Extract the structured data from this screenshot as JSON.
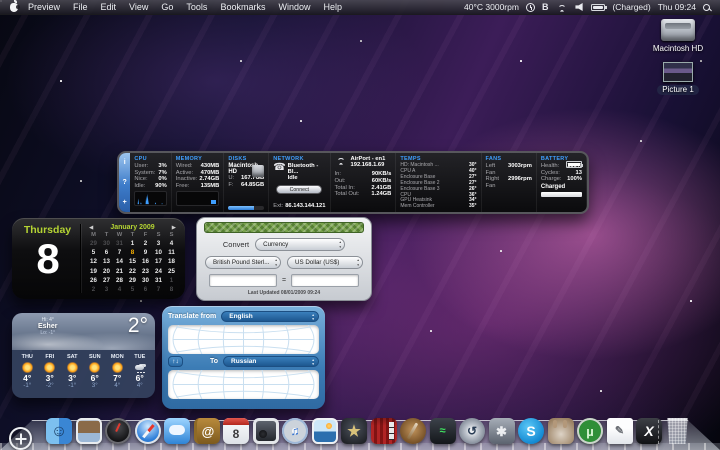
{
  "menu_bar": {
    "menus": [
      "Preview",
      "File",
      "Edit",
      "View",
      "Go",
      "Tools",
      "Bookmarks",
      "Window",
      "Help"
    ],
    "status_text": "40°C 3000rpm",
    "bluetooth_glyph": "B",
    "battery_label": "(Charged)",
    "clock": "Thu 09:24"
  },
  "desktop": {
    "hd_label": "Macintosh HD",
    "picture_label": "Picture 1"
  },
  "istat": {
    "strip_buttons": [
      "i",
      "?",
      "+"
    ],
    "cpu": {
      "header": "CPU",
      "rows": [
        {
          "l": "User:",
          "v": "3%"
        },
        {
          "l": "System:",
          "v": "7%"
        },
        {
          "l": "Nice:",
          "v": "0%"
        },
        {
          "l": "Idle:",
          "v": "90%"
        }
      ]
    },
    "memory": {
      "header": "MEMORY",
      "rows": [
        {
          "l": "Wired:",
          "v": "430MB"
        },
        {
          "l": "Active:",
          "v": "470MB"
        },
        {
          "l": "Inactive:",
          "v": "2.74GB"
        },
        {
          "l": "Free:",
          "v": "135MB"
        }
      ]
    },
    "disks": {
      "header": "DISKS",
      "volume": "Macintosh HD",
      "rows": [
        {
          "l": "U:",
          "v": "167.7GB"
        },
        {
          "l": "F:",
          "v": "64.85GB"
        }
      ]
    },
    "network": {
      "header": "NETWORK",
      "device": "Bluetooth - Bl...",
      "state": "Idle",
      "connect_label": "Connect",
      "ext": {
        "l": "Ext:",
        "v": "86.143.144.121"
      }
    },
    "airport": {
      "name": "AirPort - en1",
      "ip": "192.168.1.69",
      "rows": [
        {
          "l": "In:",
          "v": "90KB/s"
        },
        {
          "l": "Out:",
          "v": "60KB/s"
        },
        {
          "l": "Total In:",
          "v": "2.41GB"
        },
        {
          "l": "Total Out:",
          "v": "1.24GB"
        }
      ]
    },
    "temps": {
      "header": "TEMPS",
      "rows": [
        {
          "l": "HD: Macintosh ...",
          "v": "30°"
        },
        {
          "l": "CPU A",
          "v": "40°"
        },
        {
          "l": "Enclosure Base",
          "v": "27°"
        },
        {
          "l": "Enclosure Base 2",
          "v": "27°"
        },
        {
          "l": "Enclosure Base 3",
          "v": "26°"
        },
        {
          "l": "CPU",
          "v": "36°"
        },
        {
          "l": "GPU Heatsink",
          "v": "34°"
        },
        {
          "l": "Mem Controller",
          "v": "35°"
        }
      ]
    },
    "fans": {
      "header": "FANS",
      "rows": [
        {
          "l": "Left Fan",
          "v": "3003rpm"
        },
        {
          "l": "Right Fan",
          "v": "2996rpm"
        }
      ]
    },
    "battery": {
      "header": "BATTERY",
      "rows": [
        {
          "l": "Health:",
          "v": "100%"
        },
        {
          "l": "Cycles:",
          "v": "13"
        },
        {
          "l": "Charge:",
          "v": "100%"
        }
      ],
      "state": "Charged"
    }
  },
  "calendar": {
    "day_name": "Thursday",
    "big_day": "8",
    "prev": "◀",
    "next": "▶",
    "month": "January 2009",
    "dow": [
      "M",
      "T",
      "W",
      "T",
      "F",
      "S",
      "S"
    ],
    "cells": [
      {
        "d": "29",
        "c": "dim"
      },
      {
        "d": "30",
        "c": "dim"
      },
      {
        "d": "31",
        "c": "dim"
      },
      {
        "d": "1"
      },
      {
        "d": "2"
      },
      {
        "d": "3"
      },
      {
        "d": "4"
      },
      {
        "d": "5"
      },
      {
        "d": "6"
      },
      {
        "d": "7"
      },
      {
        "d": "8",
        "c": "today"
      },
      {
        "d": "9"
      },
      {
        "d": "10"
      },
      {
        "d": "11"
      },
      {
        "d": "12"
      },
      {
        "d": "13"
      },
      {
        "d": "14"
      },
      {
        "d": "15"
      },
      {
        "d": "16"
      },
      {
        "d": "17"
      },
      {
        "d": "18"
      },
      {
        "d": "19"
      },
      {
        "d": "20"
      },
      {
        "d": "21"
      },
      {
        "d": "22"
      },
      {
        "d": "23"
      },
      {
        "d": "24"
      },
      {
        "d": "25"
      },
      {
        "d": "26"
      },
      {
        "d": "27"
      },
      {
        "d": "28"
      },
      {
        "d": "29"
      },
      {
        "d": "30"
      },
      {
        "d": "31"
      },
      {
        "d": "1",
        "c": "dim"
      },
      {
        "d": "2",
        "c": "dim"
      },
      {
        "d": "3",
        "c": "dim"
      },
      {
        "d": "4",
        "c": "dim"
      },
      {
        "d": "5",
        "c": "dim"
      },
      {
        "d": "6",
        "c": "dim"
      },
      {
        "d": "7",
        "c": "dim"
      },
      {
        "d": "8",
        "c": "dim"
      }
    ]
  },
  "converter": {
    "convert_label": "Convert",
    "category": "Currency",
    "from_currency": "British Pound Sterl...",
    "to_currency": "US Dollar (US$)",
    "equals": "=",
    "last_updated": "Last Updated 08/01/2009 09:24"
  },
  "translator": {
    "from_label": "Translate from",
    "from_lang": "English",
    "to_label": "To",
    "to_lang": "Russian"
  },
  "weather": {
    "hi": "Hi: 4°",
    "location": "Esher",
    "lo": "Lo: -1°",
    "current": "2°",
    "days": [
      {
        "name": "THU",
        "icon": "sun",
        "hi": "4°",
        "lo": "-1°"
      },
      {
        "name": "FRI",
        "icon": "sun",
        "hi": "3°",
        "lo": "-2°"
      },
      {
        "name": "SAT",
        "icon": "sun",
        "hi": "3°",
        "lo": "-1°"
      },
      {
        "name": "SUN",
        "icon": "sun",
        "hi": "6°",
        "lo": "3°"
      },
      {
        "name": "MON",
        "icon": "sun",
        "hi": "7°",
        "lo": "4°"
      },
      {
        "name": "TUE",
        "icon": "snow",
        "hi": "6°",
        "lo": "4°"
      }
    ]
  },
  "dock": {
    "items": [
      {
        "name": "finder-icon",
        "cls": "finder",
        "glyph": "☺"
      },
      {
        "name": "preview-icon",
        "cls": "preview",
        "glyph": ""
      },
      {
        "name": "dashboard-icon",
        "cls": "dashboard",
        "glyph": ""
      },
      {
        "name": "safari-icon",
        "cls": "safari",
        "glyph": ""
      },
      {
        "name": "ichat-icon",
        "cls": "ichat",
        "glyph": ""
      },
      {
        "name": "address-book-icon",
        "cls": "addressbook",
        "glyph": "@"
      },
      {
        "name": "ical-icon",
        "cls": "ical",
        "glyph": "8"
      },
      {
        "name": "photo-frame-app-icon",
        "cls": "photos",
        "glyph": ""
      },
      {
        "name": "itunes-icon",
        "cls": "itunes",
        "glyph": "♫"
      },
      {
        "name": "iphoto-icon",
        "cls": "iphoto",
        "glyph": ""
      },
      {
        "name": "imovie-icon",
        "cls": "imovie",
        "glyph": "★"
      },
      {
        "name": "photo-booth-icon",
        "cls": "photobooth",
        "glyph": ""
      },
      {
        "name": "garageband-icon",
        "cls": "garageband",
        "glyph": ""
      },
      {
        "name": "activity-monitor-icon",
        "cls": "activity-monitor",
        "glyph": "≈"
      },
      {
        "name": "time-machine-icon",
        "cls": "timemachine",
        "glyph": "↺"
      },
      {
        "name": "system-preferences-icon",
        "cls": "sysprefs",
        "glyph": "✱"
      },
      {
        "name": "skype-icon",
        "cls": "skype",
        "glyph": "S"
      },
      {
        "name": "amule-icon",
        "cls": "amule",
        "glyph": ""
      },
      {
        "name": "utorrent-icon",
        "cls": "utorrent",
        "glyph": "µ"
      },
      {
        "name": "textedit-icon",
        "cls": "textedit",
        "glyph": "✎"
      },
      {
        "name": "x11-icon",
        "cls": "x11",
        "glyph": "X"
      }
    ]
  },
  "colors": {
    "istat_accent": "#3f9fff",
    "calendar_green": "#b4d333",
    "today_orange": "#ffb400",
    "translator_blue": "#3c7cb5"
  }
}
